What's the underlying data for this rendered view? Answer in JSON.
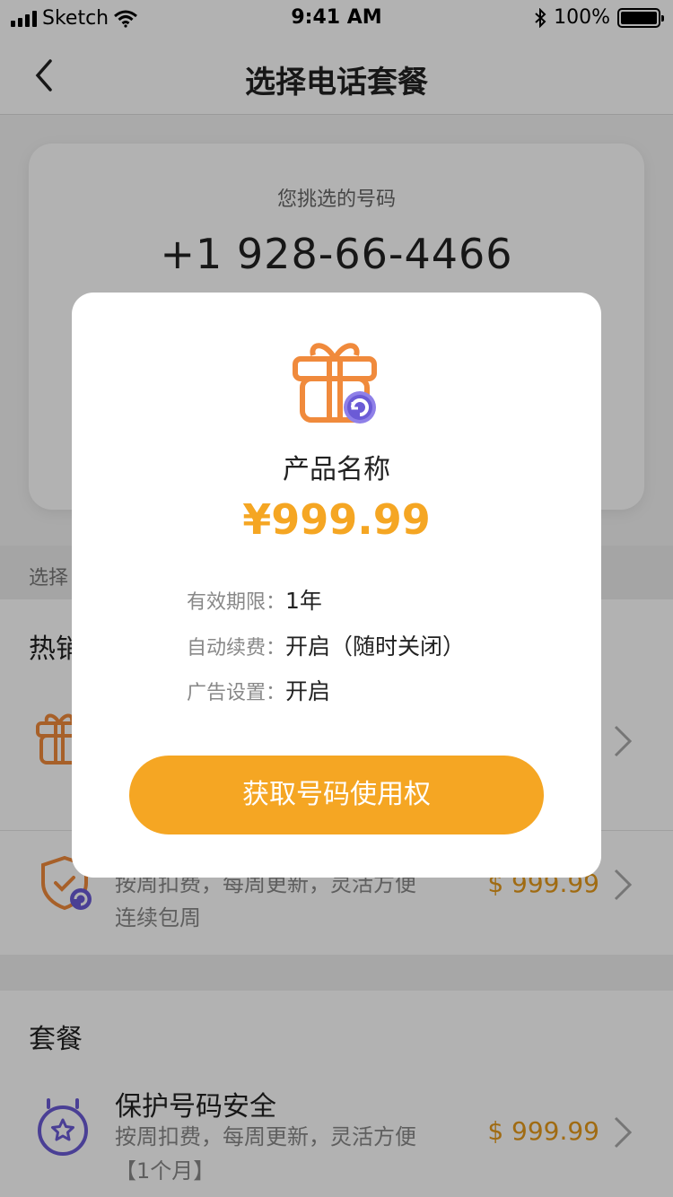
{
  "status_bar": {
    "carrier": "Sketch",
    "time": "9:41 AM",
    "battery": "100%"
  },
  "nav": {
    "title": "选择电话套餐"
  },
  "number_card": {
    "label": "您挑选的号码",
    "number": "+1 928-66-4466"
  },
  "section_strip": {
    "label": "选择"
  },
  "hot_section": {
    "title": "热销"
  },
  "hot_items": [
    {
      "desc_lines": [
        "按周扣费，每周更新，灵活方便",
        "连续包周"
      ],
      "price": "$ 999.99"
    }
  ],
  "plan_section": {
    "title": "套餐"
  },
  "plan_items": [
    {
      "title": "保护号码安全",
      "desc_lines": [
        "按周扣费，每周更新，灵活方便",
        "【1个月】"
      ],
      "price": "$ 999.99"
    }
  ],
  "modal": {
    "product_name": "产品名称",
    "price": "¥999.99",
    "rows": [
      {
        "key": "有效期限：",
        "value": "1年"
      },
      {
        "key": "自动续费：",
        "value": "开启（随时关闭）"
      },
      {
        "key": "广告设置：",
        "value": "开启"
      }
    ],
    "cta_label": "获取号码使用权"
  },
  "colors": {
    "accent": "#f5a623",
    "icon_orange": "#f08a3c",
    "badge_purple": "#6b5bd6"
  }
}
